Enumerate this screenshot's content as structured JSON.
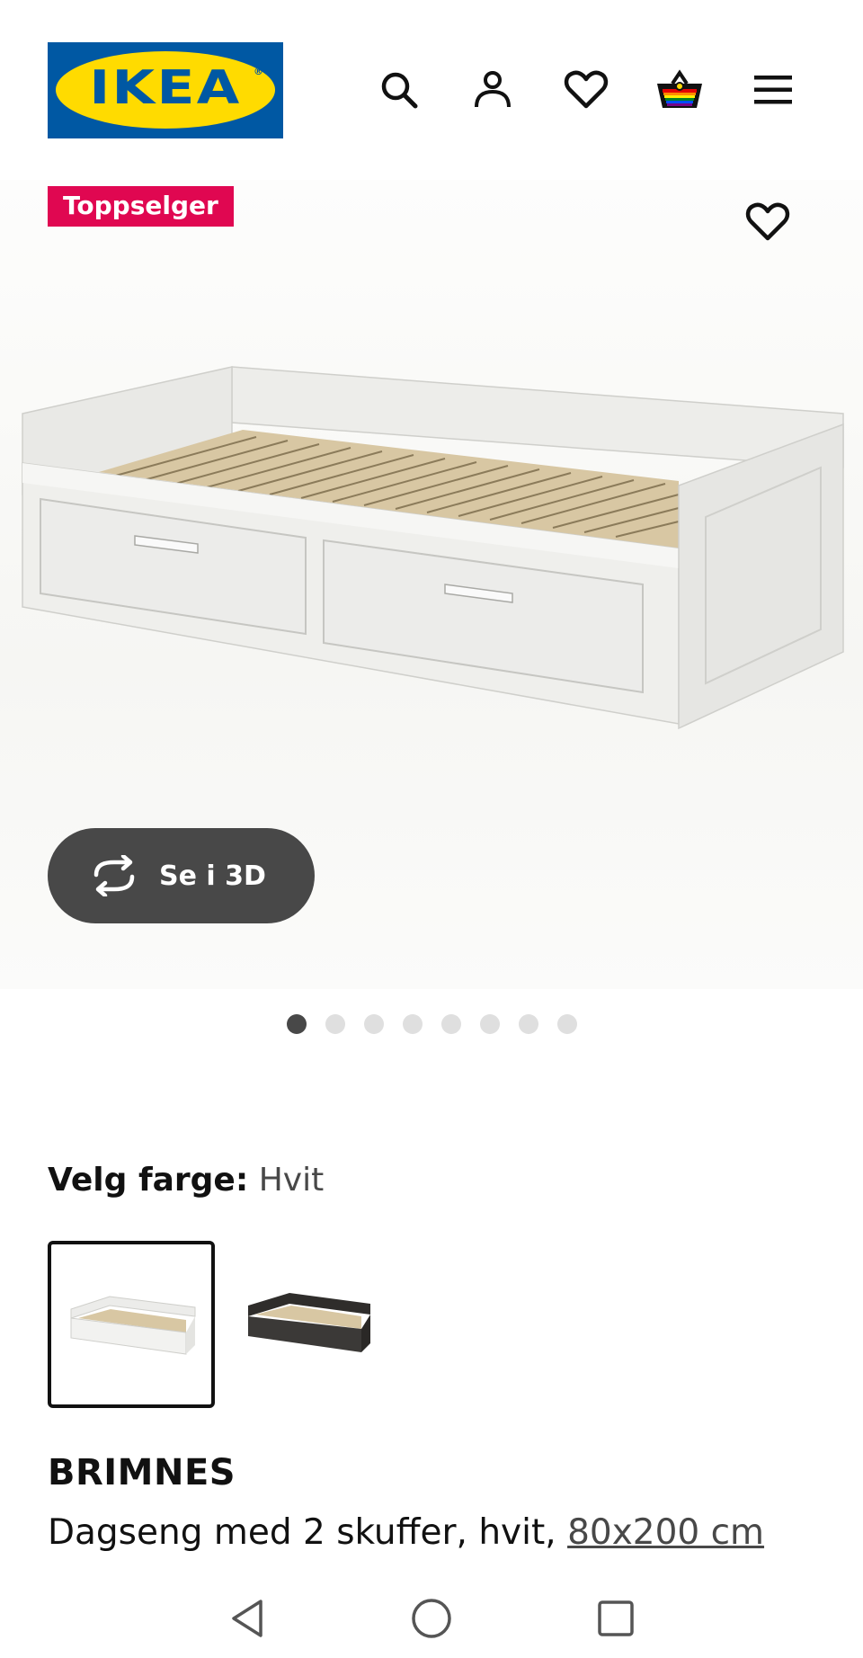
{
  "header": {
    "logo_text": "IKEA",
    "logo_reg": "®",
    "icons": [
      "search-icon",
      "account-icon",
      "heart-icon",
      "basket-icon",
      "menu-icon"
    ]
  },
  "gallery": {
    "badge": "Toppselger",
    "view_3d_label": "Se i 3D",
    "image_count": 8,
    "active_index": 0
  },
  "color": {
    "label": "Velg farge:",
    "value": "Hvit",
    "options": [
      "white",
      "black-brown"
    ]
  },
  "product": {
    "name": "BRIMNES",
    "description": "Dagseng med 2 skuffer, hvit,",
    "size": "80x200 cm"
  },
  "colors": {
    "ikea_blue": "#0058a3",
    "ikea_yellow": "#ffdb00",
    "badge_red": "#e00751",
    "dark_button": "#484848"
  }
}
